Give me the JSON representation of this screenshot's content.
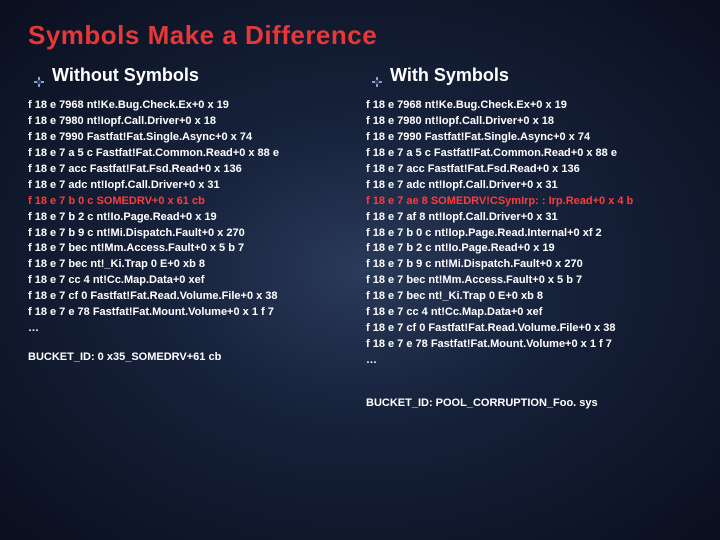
{
  "title": "Symbols Make a Difference",
  "left": {
    "heading": "Without Symbols",
    "lines": [
      {
        "text": "f 18 e 7968 nt!Ke.Bug.Check.Ex+0 x 19",
        "hl": false
      },
      {
        "text": "f 18 e 7980 nt!Iopf.Call.Driver+0 x 18",
        "hl": false
      },
      {
        "text": "f 18 e 7990 Fastfat!Fat.Single.Async+0 x 74",
        "hl": false
      },
      {
        "text": "f 18 e 7 a 5 c Fastfat!Fat.Common.Read+0 x 88 e",
        "hl": false
      },
      {
        "text": "f 18 e 7 acc Fastfat!Fat.Fsd.Read+0 x 136",
        "hl": false
      },
      {
        "text": "f 18 e 7 adc nt!Iopf.Call.Driver+0 x 31",
        "hl": false
      },
      {
        "text": "f 18 e 7 b 0 c SOMEDRV+0 x 61 cb",
        "hl": true
      },
      {
        "text": "f 18 e 7 b 2 c nt!Io.Page.Read+0 x 19",
        "hl": false
      },
      {
        "text": "f 18 e 7 b 9 c nt!Mi.Dispatch.Fault+0 x 270",
        "hl": false
      },
      {
        "text": "f 18 e 7 bec nt!Mm.Access.Fault+0 x 5 b 7",
        "hl": false
      },
      {
        "text": "f 18 e 7 bec nt!_Ki.Trap 0 E+0 xb 8",
        "hl": false
      },
      {
        "text": "f 18 e 7 cc 4 nt!Cc.Map.Data+0 xef",
        "hl": false
      },
      {
        "text": "f 18 e 7 cf 0 Fastfat!Fat.Read.Volume.File+0 x 38",
        "hl": false
      },
      {
        "text": "f 18 e 7 e 78 Fastfat!Fat.Mount.Volume+0 x 1 f 7",
        "hl": false
      },
      {
        "text": "…",
        "hl": false
      }
    ],
    "bucket": "BUCKET_ID:  0 x35_SOMEDRV+61 cb"
  },
  "right": {
    "heading": "With Symbols",
    "lines": [
      {
        "text": "f 18 e 7968 nt!Ke.Bug.Check.Ex+0 x 19",
        "hl": false
      },
      {
        "text": "f 18 e 7980 nt!Iopf.Call.Driver+0 x 18",
        "hl": false
      },
      {
        "text": "f 18 e 7990 Fastfat!Fat.Single.Async+0 x 74",
        "hl": false
      },
      {
        "text": "f 18 e 7 a 5 c Fastfat!Fat.Common.Read+0 x 88 e",
        "hl": false
      },
      {
        "text": "f 18 e 7 acc Fastfat!Fat.Fsd.Read+0 x 136",
        "hl": false
      },
      {
        "text": "f 18 e 7 adc nt!Iopf.Call.Driver+0 x 31",
        "hl": false
      },
      {
        "text": "f 18 e 7 ae 8 SOMEDRV!CSymIrp: : Irp.Read+0 x 4 b",
        "hl": true
      },
      {
        "text": "f 18 e 7 af 8 nt!Iopf.Call.Driver+0 x 31",
        "hl": false
      },
      {
        "text": "f 18 e 7 b 0 c nt!Iop.Page.Read.Internal+0 xf 2",
        "hl": false
      },
      {
        "text": "f 18 e 7 b 2 c nt!Io.Page.Read+0 x 19",
        "hl": false
      },
      {
        "text": "f 18 e 7 b 9 c nt!Mi.Dispatch.Fault+0 x 270",
        "hl": false
      },
      {
        "text": "f 18 e 7 bec nt!Mm.Access.Fault+0 x 5 b 7",
        "hl": false
      },
      {
        "text": "f 18 e 7 bec nt!_Ki.Trap 0 E+0 xb 8",
        "hl": false
      },
      {
        "text": "f 18 e 7 cc 4 nt!Cc.Map.Data+0 xef",
        "hl": false
      },
      {
        "text": "f 18 e 7 cf 0 Fastfat!Fat.Read.Volume.File+0 x 38",
        "hl": false
      },
      {
        "text": "f 18 e 7 e 78 Fastfat!Fat.Mount.Volume+0 x 1 f 7",
        "hl": false
      },
      {
        "text": "…",
        "hl": false
      }
    ],
    "bucket": "BUCKET_ID: POOL_CORRUPTION_Foo. sys"
  },
  "accent_color": "#e63838"
}
